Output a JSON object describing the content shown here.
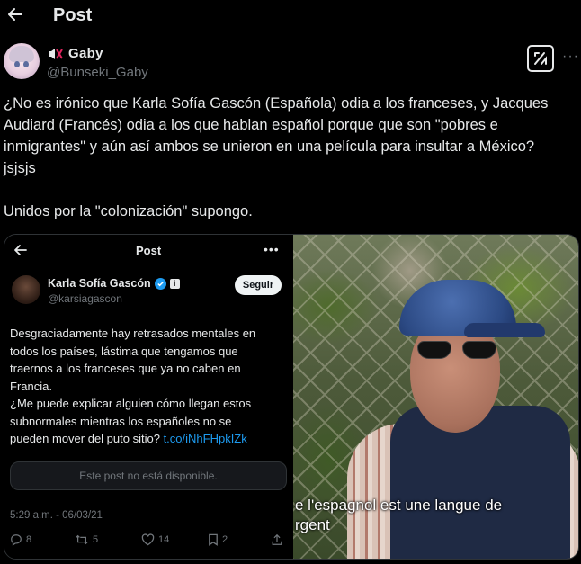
{
  "header": {
    "title": "Post"
  },
  "author": {
    "display_name": "Gaby",
    "handle": "@Bunseki_Gaby"
  },
  "tweet": {
    "line1": "¿No es irónico que Karla Sofía Gascón (Española) odia a los franceses, y Jacques",
    "line2": "Audiard (Francés) odia a los que hablan español porque que son \"pobres e",
    "line3": "inmigrantes\" y aún así ambos se unieron en una película para insultar a México?",
    "line4": "jsjsjs",
    "line5": "Unidos por la \"colonización\" supongo."
  },
  "embedded": {
    "title": "Post",
    "name": "Karla Sofía Gascón",
    "handle": "@karsiagascon",
    "follow_label": "Seguir",
    "body_l1": "Desgraciadamente hay retrasados mentales en",
    "body_l2": "todos los países, lástima que tengamos que",
    "body_l3": "traernos a los franceses que ya no caben en",
    "body_l4": "Francia.",
    "body_l5": "¿Me puede explicar alguien cómo llegan estos",
    "body_l6": "subnormales mientras los españoles no se",
    "body_l7_prefix": "pueden mover del puto sitio? ",
    "body_link": "t.co/iNhFHpkIZk",
    "unavailable": "Este post no está disponible.",
    "timestamp": "5:29 a.m. - 06/03/21",
    "replies": "8",
    "reposts": "5",
    "likes": "14",
    "bookmarks": "2"
  },
  "video": {
    "subtitle_l1": "e l'espagnol est une langue de",
    "subtitle_l2": "rgent"
  },
  "colors": {
    "link": "#1d9bf0",
    "muted": "#71767b",
    "text": "#e7e9ea",
    "background": "#000000"
  },
  "icons": [
    "back-arrow-icon",
    "speaker-muted-icon",
    "grok-icon",
    "more-icon",
    "verified-icon",
    "reply-icon",
    "repost-icon",
    "like-icon",
    "bookmark-icon",
    "share-icon"
  ]
}
